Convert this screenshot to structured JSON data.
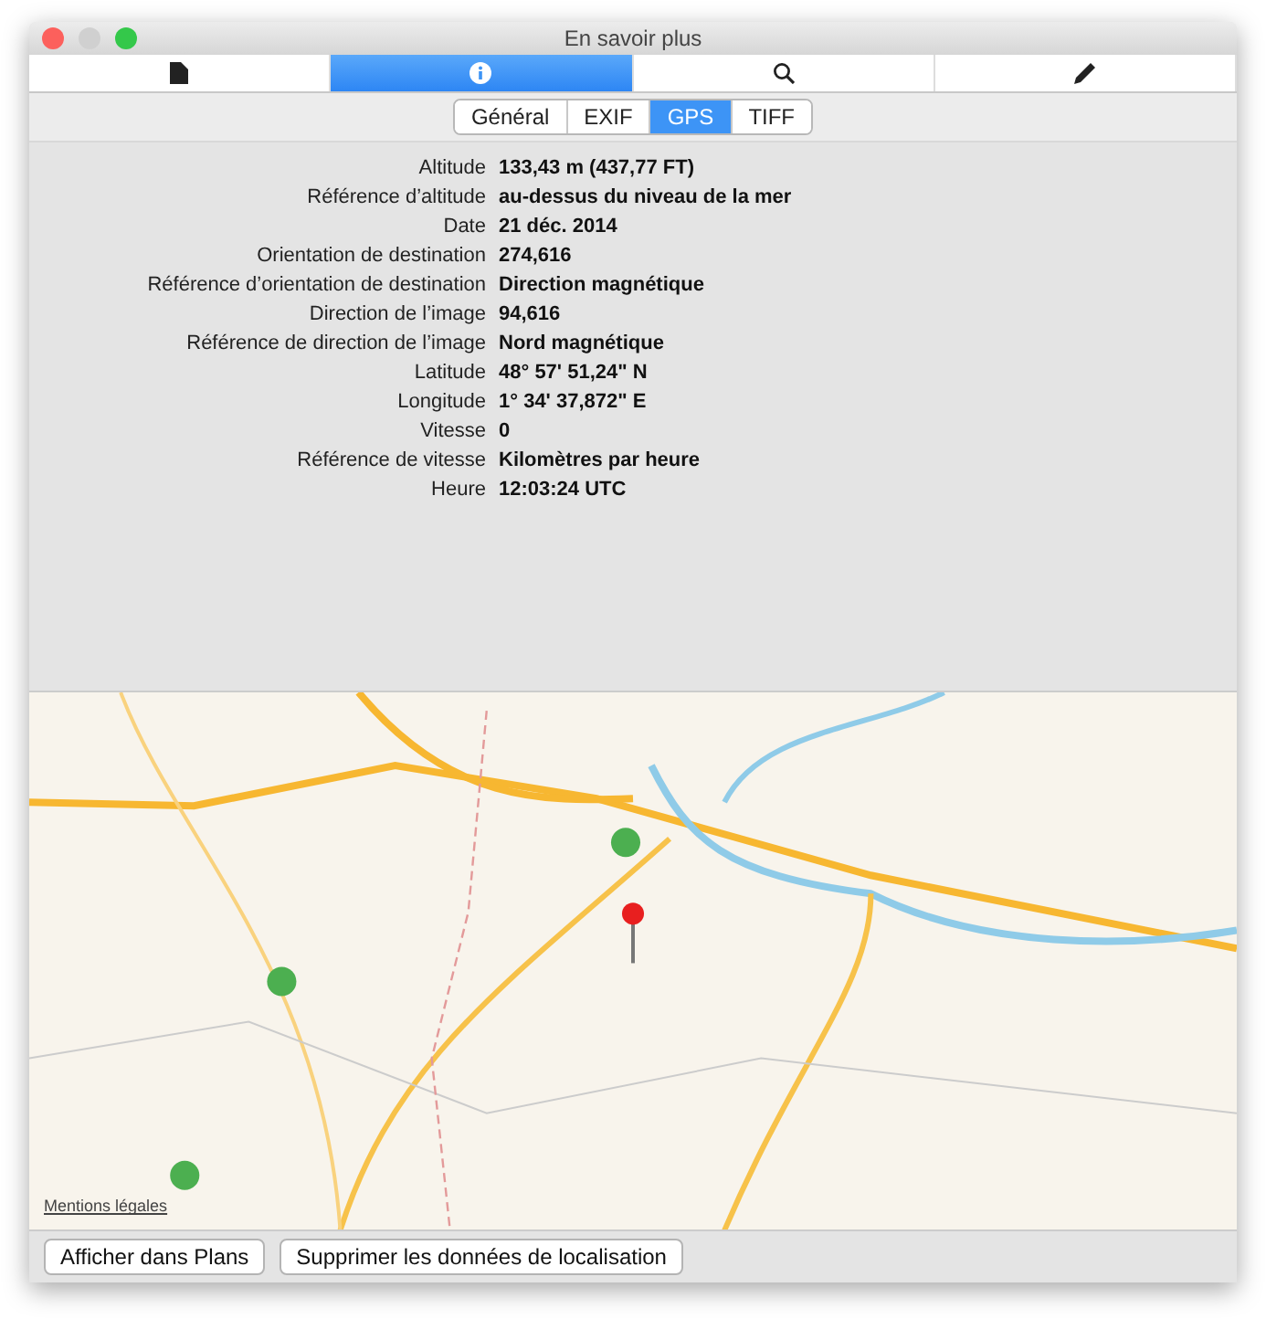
{
  "window": {
    "title": "En savoir plus"
  },
  "toolbar_tabs": [
    {
      "kind": "document",
      "selected": false
    },
    {
      "kind": "info",
      "selected": true
    },
    {
      "kind": "search",
      "selected": false
    },
    {
      "kind": "pencil",
      "selected": false
    }
  ],
  "segments": [
    {
      "label": "Général",
      "selected": false
    },
    {
      "label": "EXIF",
      "selected": false
    },
    {
      "label": "GPS",
      "selected": true
    },
    {
      "label": "TIFF",
      "selected": false
    }
  ],
  "properties": [
    {
      "label": "Altitude",
      "value": "133,43 m (437,77 FT)"
    },
    {
      "label": "Référence d’altitude",
      "value": "au-dessus du niveau de la mer"
    },
    {
      "label": "Date",
      "value": "21 déc. 2014"
    },
    {
      "label": "Orientation de destination",
      "value": "274,616"
    },
    {
      "label": "Référence d’orientation de destination",
      "value": "Direction magnétique"
    },
    {
      "label": "Direction de l’image",
      "value": "94,616"
    },
    {
      "label": "Référence de direction de l’image",
      "value": "Nord magnétique"
    },
    {
      "label": "Latitude",
      "value": "48° 57' 51,24\" N"
    },
    {
      "label": "Longitude",
      "value": "1° 34' 37,872\" E"
    },
    {
      "label": "Vitesse",
      "value": "0"
    },
    {
      "label": "Référence de vitesse",
      "value": "Kilomètres par heure"
    },
    {
      "label": "Heure",
      "value": "12:03:24 UTC"
    }
  ],
  "map": {
    "legal_link": "Mentions légales"
  },
  "buttons": [
    "Afficher dans Plans",
    "Supprimer les données de localisation"
  ]
}
